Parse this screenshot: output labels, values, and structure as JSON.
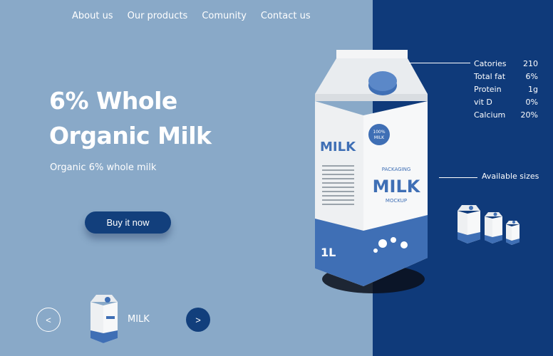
{
  "nav": {
    "items": [
      "About us",
      "Our products",
      "Comunity",
      "Contact us"
    ]
  },
  "hero": {
    "title_line1": "6% Whole",
    "title_line2": "Organic Milk",
    "subtitle": "Organic 6% whole milk",
    "buy_label": "Buy it now"
  },
  "carousel": {
    "prev_label": "<",
    "next_label": ">",
    "item_label": "MILK"
  },
  "product": {
    "carton_text_main": "MILK",
    "carton_text_top": "PACKAGING",
    "carton_text_bottom": "MOCKUP",
    "badge_line1": "100%",
    "badge_line2": "MILK",
    "volume": "1L"
  },
  "nutrition": {
    "rows": [
      {
        "name": "Catories",
        "value": "210"
      },
      {
        "name": "Total fat",
        "value": "6%"
      },
      {
        "name": "Protein",
        "value": "1g"
      },
      {
        "name": "vit D",
        "value": "0%"
      },
      {
        "name": "Calcium",
        "value": "20%"
      }
    ]
  },
  "sizes": {
    "label": "Available sizes"
  },
  "colors": {
    "left_bg": "#89a9c8",
    "right_bg": "#0f3a7a",
    "accent": "#123f7c",
    "carton_blue": "#3f6fb5"
  }
}
